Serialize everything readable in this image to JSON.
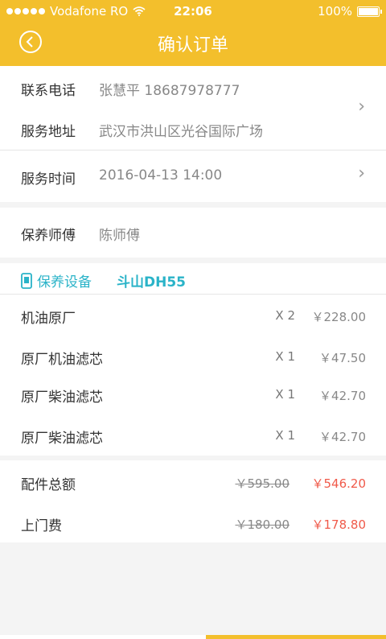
{
  "status_bar": {
    "carrier": "Vodafone RO",
    "time": "22:06",
    "battery": "100%"
  },
  "header": {
    "title": "确认订单"
  },
  "contact": {
    "phone_label": "联系电话",
    "phone_value": "张慧平 18687978777",
    "address_label": "服务地址",
    "address_value": "武汉市洪山区光谷国际广场"
  },
  "service_time": {
    "label": "服务时间",
    "value": "2016-04-13 14:00"
  },
  "technician": {
    "label": "保养师傅",
    "value": "陈师傅"
  },
  "equipment": {
    "title": "保养设备",
    "name": "斗山DH55"
  },
  "items": [
    {
      "name": "机油原厂",
      "qty": "X 2",
      "price": "￥228.00"
    },
    {
      "name": "原厂机油滤芯",
      "qty": "X 1",
      "price": "￥47.50"
    },
    {
      "name": "原厂柴油滤芯",
      "qty": "X 1",
      "price": "￥42.70"
    },
    {
      "name": "原厂柴油滤芯",
      "qty": "X 1",
      "price": "￥42.70"
    }
  ],
  "totals": {
    "parts_label": "配件总额",
    "parts_old": "￥595.00",
    "parts_new": "￥546.20",
    "visit_label": "上门费",
    "visit_old": "￥180.00",
    "visit_new": "￥178.80"
  },
  "colors": {
    "brand": "#f3bf2c",
    "accent": "#2ab3c8",
    "price_red": "#f05a4a"
  }
}
